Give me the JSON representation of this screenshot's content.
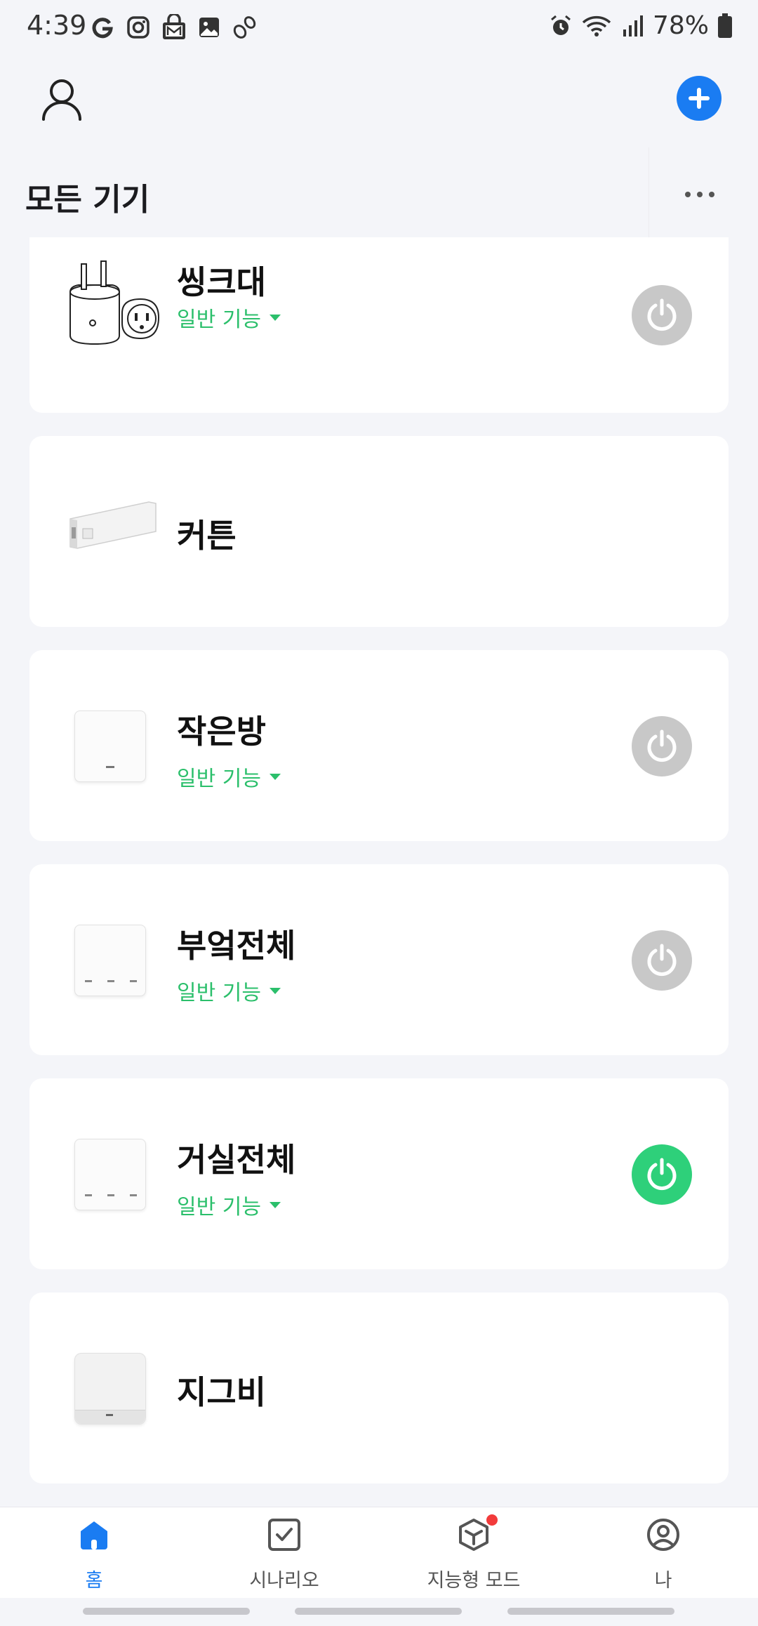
{
  "status_bar": {
    "time": "4:39",
    "battery": "78%",
    "icons_left": [
      "google-icon",
      "instagram-icon",
      "gmail-lock-icon",
      "gallery-icon",
      "footprint-icon"
    ],
    "icons_right": [
      "alarm-icon",
      "wifi-icon",
      "signal-icon",
      "battery-icon"
    ]
  },
  "header": {
    "section_title": "모든 기기"
  },
  "devices": [
    {
      "name": "씽크대",
      "function_label": "일반 기능",
      "icon": "smart-plug-icon",
      "has_power": true,
      "power_on": false
    },
    {
      "name": "커튼",
      "function_label": "",
      "icon": "curtain-motor-icon",
      "has_power": false,
      "power_on": false
    },
    {
      "name": "작은방",
      "function_label": "일반 기능",
      "icon": "one-gang-switch-icon",
      "has_power": true,
      "power_on": false
    },
    {
      "name": "부엌전체",
      "function_label": "일반 기능",
      "icon": "three-gang-switch-icon",
      "has_power": true,
      "power_on": false
    },
    {
      "name": "거실전체",
      "function_label": "일반 기능",
      "icon": "three-gang-switch-icon",
      "has_power": true,
      "power_on": true
    },
    {
      "name": "지그비",
      "function_label": "",
      "icon": "zigbee-hub-icon",
      "has_power": false,
      "power_on": false
    }
  ],
  "bottom_nav": {
    "items": [
      {
        "label": "홈",
        "icon": "home-icon",
        "active": true
      },
      {
        "label": "시나리오",
        "icon": "checkbox-icon",
        "active": false
      },
      {
        "label": "지능형 모드",
        "icon": "cube-icon",
        "active": false,
        "badge": true
      },
      {
        "label": "나",
        "icon": "user-circle-icon",
        "active": false
      }
    ]
  },
  "colors": {
    "accent": "#1a7cf2",
    "function_green": "#2bbf6b",
    "power_on": "#2ed07a",
    "power_off": "#c8c8c8",
    "background": "#f4f5f9"
  }
}
